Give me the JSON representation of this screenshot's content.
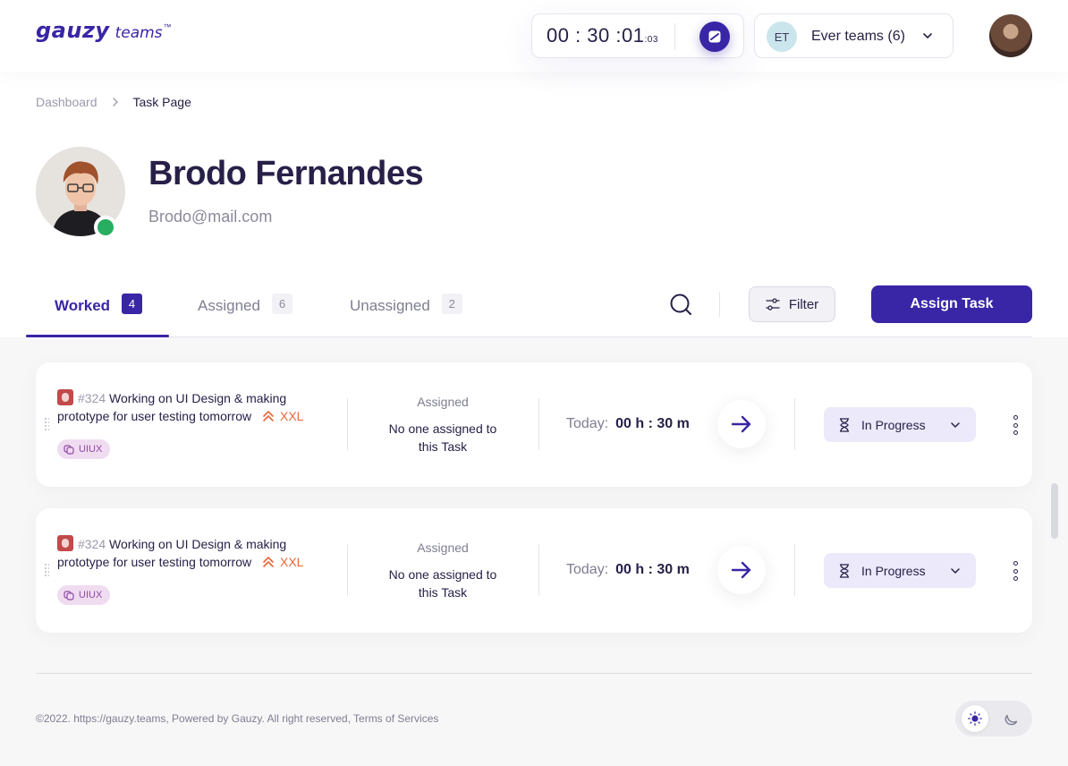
{
  "brand": {
    "name": "gauzy",
    "sub": "teams",
    "tm": "™"
  },
  "timer": {
    "main": "00 : 30 :01",
    "ms": ":03"
  },
  "team": {
    "initials": "ET",
    "name": "Ever teams (6)"
  },
  "breadcrumb": {
    "parent": "Dashboard",
    "current": "Task Page"
  },
  "profile": {
    "name": "Brodo Fernandes",
    "email": "Brodo@mail.com"
  },
  "tabs": [
    {
      "label": "Worked",
      "count": "4"
    },
    {
      "label": "Assigned",
      "count": "6"
    },
    {
      "label": "Unassigned",
      "count": "2"
    }
  ],
  "toolbar": {
    "filter_label": "Filter",
    "assign_label": "Assign Task"
  },
  "tasks": [
    {
      "number": "#324",
      "title": "Working on UI Design & making prototype for user testing tomorrow",
      "size": "XXL",
      "tag": "UIUX",
      "assigned_title": "Assigned",
      "assigned_text": "No one assigned to this Task",
      "time_label": "Today:",
      "time_value": "00 h : 30 m",
      "status": "In Progress"
    },
    {
      "number": "#324",
      "title": "Working on UI Design & making prototype for user testing tomorrow",
      "size": "XXL",
      "tag": "UIUX",
      "assigned_title": "Assigned",
      "assigned_text": "No one assigned to this Task",
      "time_label": "Today:",
      "time_value": "00 h : 30 m",
      "status": "In Progress"
    }
  ],
  "footer": {
    "text": "©2022. https://gauzy.teams, Powered by Gauzy. All right reserved, Terms of Services"
  },
  "colors": {
    "primary": "#3826a6",
    "bug": "#c24a4a",
    "size": "#e8673a",
    "online": "#27ae60",
    "tag_bg": "#f0dcf0"
  },
  "icons": [
    "bug-icon",
    "priority-icon",
    "tag-icon",
    "arrow-right-icon",
    "hourglass-icon",
    "chevron-down-icon",
    "more-icon",
    "search-icon",
    "filter-icon",
    "sun-icon",
    "moon-icon"
  ]
}
